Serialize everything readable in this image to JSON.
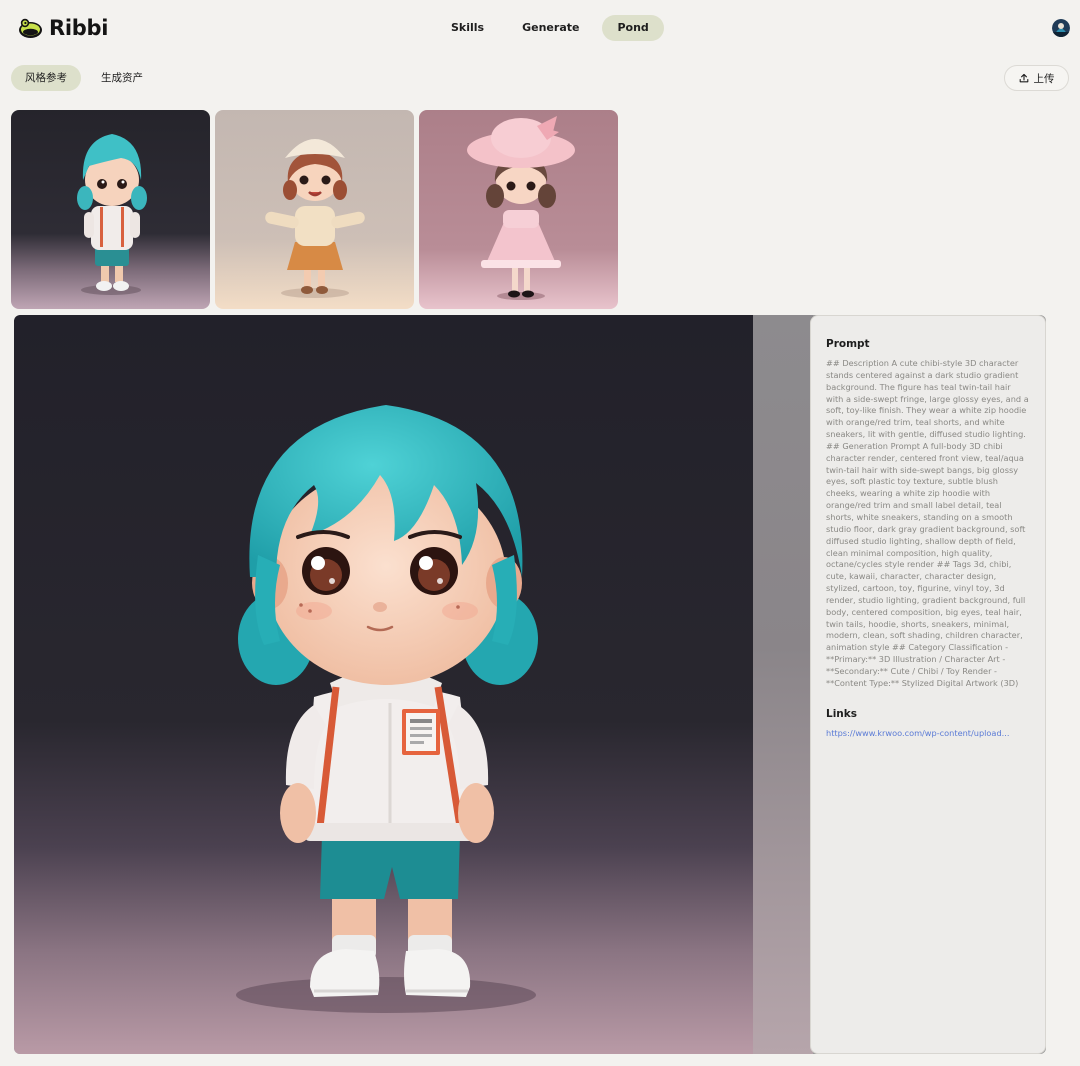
{
  "app": {
    "name": "Ribbi"
  },
  "nav": {
    "items": [
      {
        "label": "Skills",
        "active": false
      },
      {
        "label": "Generate",
        "active": false
      },
      {
        "label": "Pond",
        "active": true
      }
    ]
  },
  "subtabs": [
    {
      "label": "风格参考",
      "active": true
    },
    {
      "label": "生成资产",
      "active": false
    }
  ],
  "upload": {
    "label": "上传",
    "icon": "upload-icon"
  },
  "thumbnails": [
    {
      "subject": "chibi character with teal hair, white hoodie, teal shorts",
      "background": "#2a2933"
    },
    {
      "subject": "chibi girl with beige beret, cream cardigan, orange pleated skirt",
      "background": "#c9bcb4"
    },
    {
      "subject": "chibi girl with pink sun hat and pink dress",
      "background": "#b0858f"
    }
  ],
  "detail": {
    "prompt_heading": "Prompt",
    "prompt_text": "## Description A cute chibi-style 3D character stands centered against a dark studio gradient background. The figure has teal twin-tail hair with a side-swept fringe, large glossy eyes, and a soft, toy-like finish. They wear a white zip hoodie with orange/red trim, teal shorts, and white sneakers, lit with gentle, diffused studio lighting. ## Generation Prompt A full-body 3D chibi character render, centered front view, teal/aqua twin-tail hair with side-swept bangs, big glossy eyes, soft plastic toy texture, subtle blush cheeks, wearing a white zip hoodie with orange/red trim and small label detail, teal shorts, white sneakers, standing on a smooth studio floor, dark gray gradient background, soft diffused studio lighting, shallow depth of field, clean minimal composition, high quality, octane/cycles style render ## Tags 3d, chibi, cute, kawaii, character, character design, stylized, cartoon, toy, figurine, vinyl toy, 3d render, studio lighting, gradient background, full body, centered composition, big eyes, teal hair, twin tails, hoodie, shorts, sneakers, minimal, modern, clean, soft shading, children character, animation style ## Category Classification - **Primary:** 3D Illustration / Character Art - **Secondary:** Cute / Chibi / Toy Render - **Content Type:** Stylized Digital Artwork (3D)",
    "links_heading": "Links",
    "link": "https://www.krwoo.com/wp-content/upload..."
  },
  "colors": {
    "accent_pill": "#dde0cb",
    "page_bg": "#f3f2ef",
    "link": "#5b7bd6"
  }
}
